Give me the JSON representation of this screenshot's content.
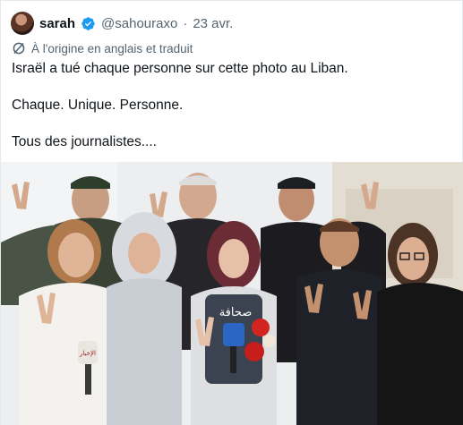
{
  "tweet": {
    "display_name": "sarah",
    "handle": "@sahouraxo",
    "separator": "·",
    "date": "23 avr.",
    "translation_note": "À l'origine en anglais et traduit",
    "paragraphs": [
      "Israël a tué chaque personne sur cette photo au Liban.",
      "Chaque. Unique. Personne.",
      "Tous des journalistes...."
    ],
    "photo": {
      "vest_text": "صحافة",
      "mic_text": "الإخبار"
    }
  },
  "colors": {
    "verified": "#1d9bf0",
    "secondary_text": "#536471",
    "primary_text": "#0f1419"
  },
  "icons": {
    "verified": "verified-badge-icon",
    "translate": "translate-icon"
  }
}
